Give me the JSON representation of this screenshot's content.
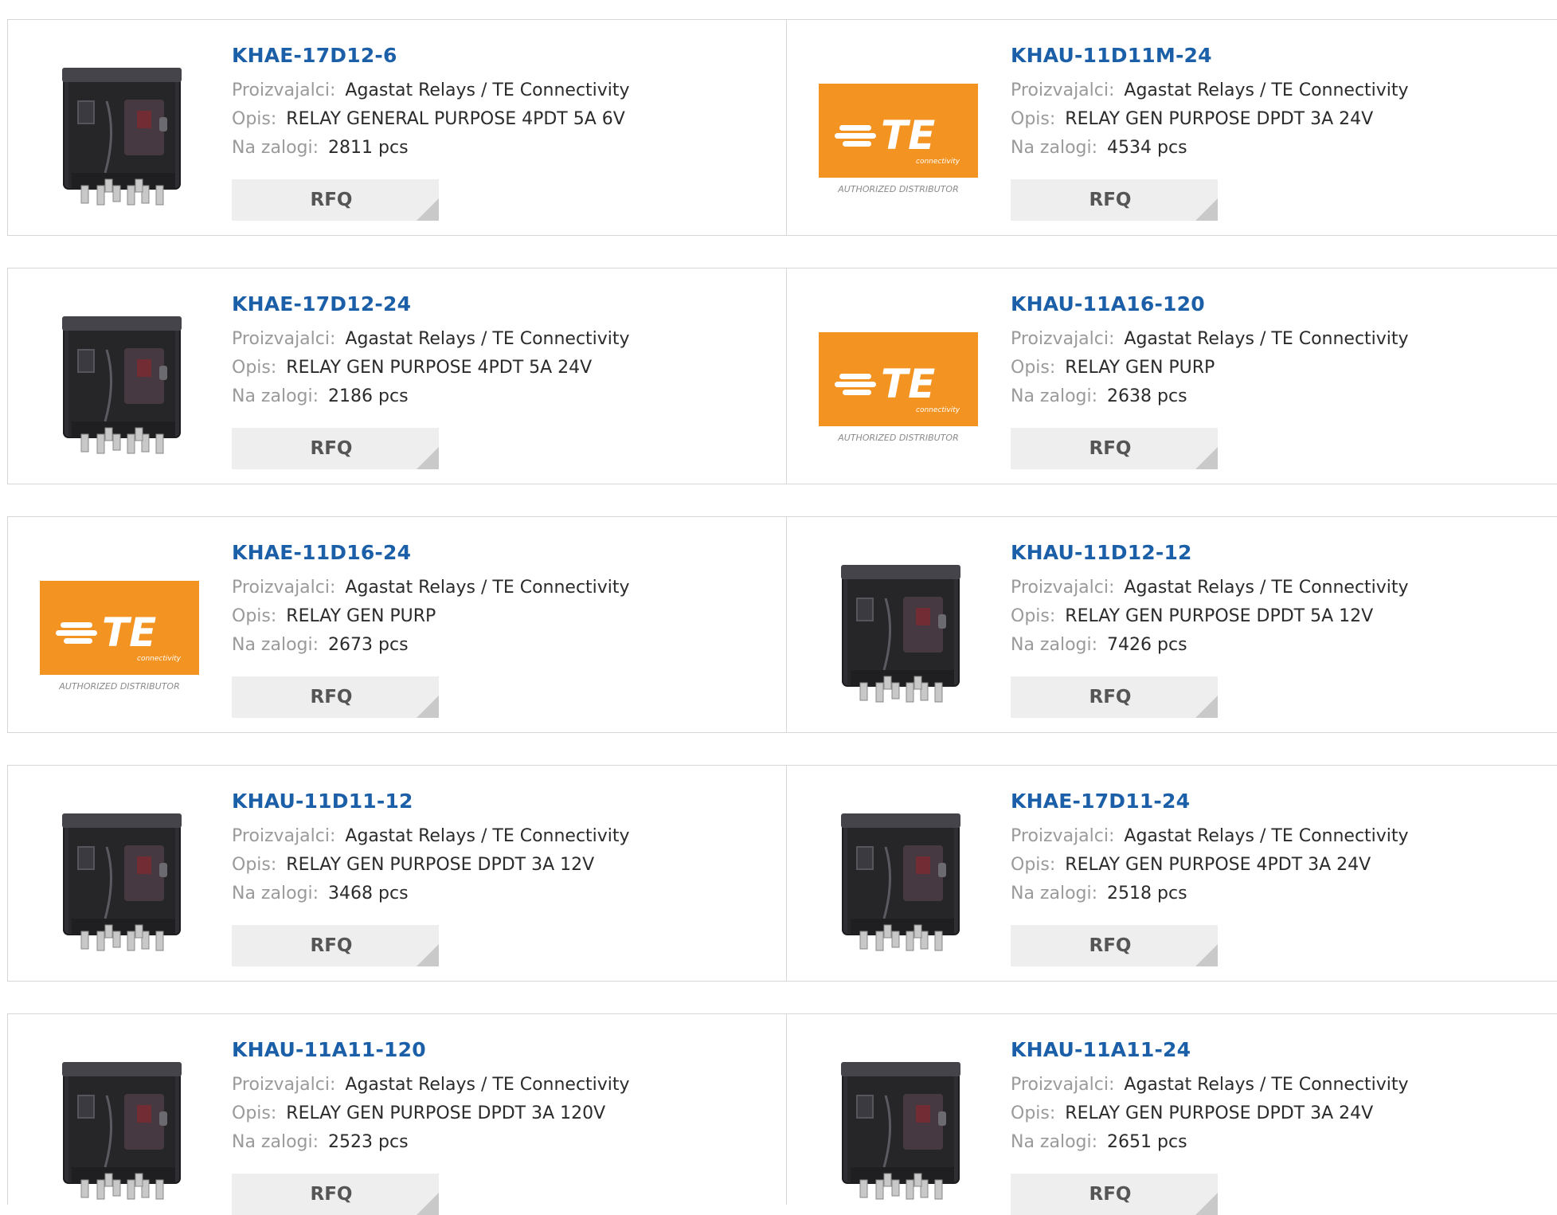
{
  "labels": {
    "manufacturer": "Proizvajalci:",
    "description": "Opis:",
    "stock": "Na zalogi:",
    "rfq": "RFQ"
  },
  "colors": {
    "link": "#1a5fa8",
    "te_orange": "#f39321",
    "border": "#d6d6d6",
    "button_bg": "#eeeeee"
  },
  "logo": {
    "brand": "TE",
    "sub": "connectivity",
    "tag": "AUTHORIZED DISTRIBUTOR"
  },
  "products": [
    {
      "name": "KHAE-17D12-6",
      "manufacturer": "Agastat Relays / TE Connectivity",
      "description": "RELAY GENERAL PURPOSE 4PDT 5A 6V",
      "stock": "2811 pcs",
      "image": "relay"
    },
    {
      "name": "KHAU-11D11M-24",
      "manufacturer": "Agastat Relays / TE Connectivity",
      "description": "RELAY GEN PURPOSE DPDT 3A 24V",
      "stock": "4534 pcs",
      "image": "te-logo"
    },
    {
      "name": "KHAE-17D12-24",
      "manufacturer": "Agastat Relays / TE Connectivity",
      "description": "RELAY GEN PURPOSE 4PDT 5A 24V",
      "stock": "2186 pcs",
      "image": "relay"
    },
    {
      "name": "KHAU-11A16-120",
      "manufacturer": "Agastat Relays / TE Connectivity",
      "description": "RELAY GEN PURP",
      "stock": "2638 pcs",
      "image": "te-logo"
    },
    {
      "name": "KHAE-11D16-24",
      "manufacturer": "Agastat Relays / TE Connectivity",
      "description": "RELAY GEN PURP",
      "stock": "2673 pcs",
      "image": "te-logo"
    },
    {
      "name": "KHAU-11D12-12",
      "manufacturer": "Agastat Relays / TE Connectivity",
      "description": "RELAY GEN PURPOSE DPDT 5A 12V",
      "stock": "7426 pcs",
      "image": "relay"
    },
    {
      "name": "KHAU-11D11-12",
      "manufacturer": "Agastat Relays / TE Connectivity",
      "description": "RELAY GEN PURPOSE DPDT 3A 12V",
      "stock": "3468 pcs",
      "image": "relay"
    },
    {
      "name": "KHAE-17D11-24",
      "manufacturer": "Agastat Relays / TE Connectivity",
      "description": "RELAY GEN PURPOSE 4PDT 3A 24V",
      "stock": "2518 pcs",
      "image": "relay"
    },
    {
      "name": "KHAU-11A11-120",
      "manufacturer": "Agastat Relays / TE Connectivity",
      "description": "RELAY GEN PURPOSE DPDT 3A 120V",
      "stock": "2523 pcs",
      "image": "relay"
    },
    {
      "name": "KHAU-11A11-24",
      "manufacturer": "Agastat Relays / TE Connectivity",
      "description": "RELAY GEN PURPOSE DPDT 3A 24V",
      "stock": "2651 pcs",
      "image": "relay"
    }
  ]
}
